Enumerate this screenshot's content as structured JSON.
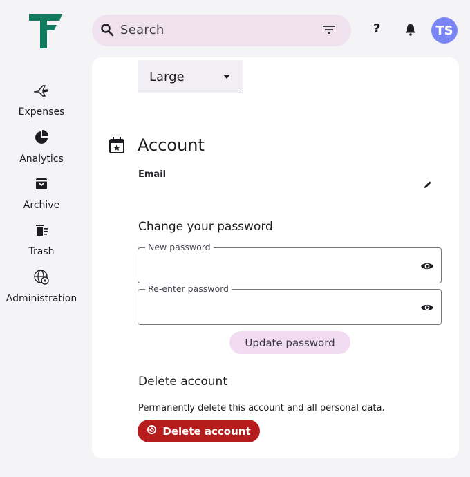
{
  "header": {
    "search_placeholder": "Search",
    "help_label": "?",
    "avatar_initials": "TS"
  },
  "sidebar": {
    "items": [
      {
        "label": "Expenses",
        "icon": "airplane-icon"
      },
      {
        "label": "Analytics",
        "icon": "pie-chart-icon"
      },
      {
        "label": "Archive",
        "icon": "archive-icon"
      },
      {
        "label": "Trash",
        "icon": "trash-icon"
      },
      {
        "label": "Administration",
        "icon": "globe-gear-icon"
      }
    ]
  },
  "main": {
    "font_size_select": "Large",
    "account_title": "Account",
    "email_label": "Email",
    "change_password_title": "Change your password",
    "new_password_label": "New password",
    "reenter_password_label": "Re-enter password",
    "update_password_button": "Update password",
    "delete_account_title": "Delete account",
    "delete_account_desc": "Permanently delete this account and all personal data.",
    "delete_account_button": "Delete account"
  },
  "colors": {
    "brand": "#127a5f",
    "avatar": "#7a85f4",
    "search_bg": "#efe2ee",
    "danger": "#b71c1c",
    "update_bg": "#f2dcf1"
  }
}
